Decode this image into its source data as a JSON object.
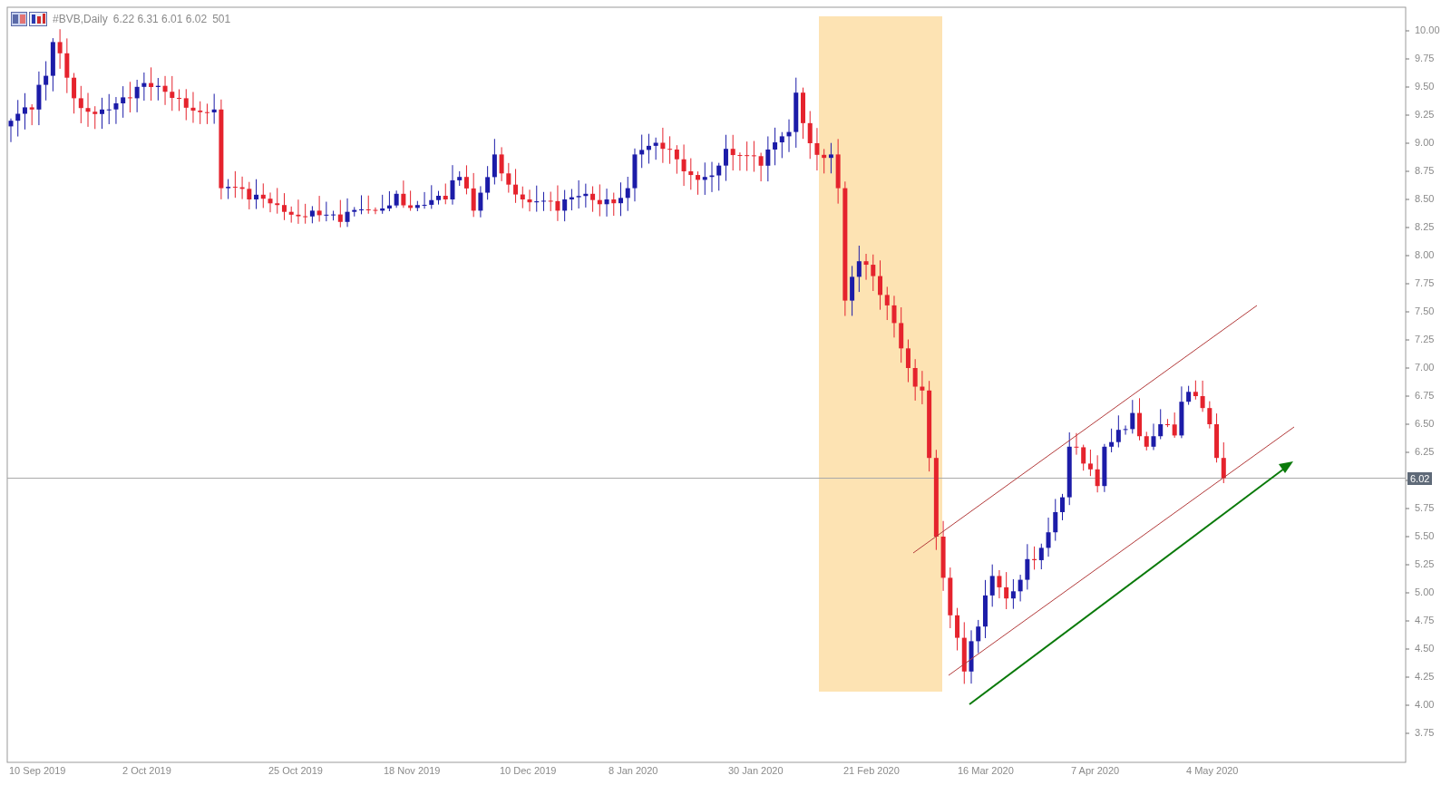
{
  "header": {
    "symbol": "#BVB,Daily",
    "ohlc": "6.22 6.31 6.01 6.02",
    "bars": "501"
  },
  "price_axis": [
    "10.00",
    "9.75",
    "9.50",
    "9.25",
    "9.00",
    "8.75",
    "8.50",
    "8.25",
    "8.00",
    "7.75",
    "7.50",
    "7.25",
    "7.00",
    "6.75",
    "6.50",
    "6.25",
    "5.75",
    "5.50",
    "5.25",
    "5.00",
    "4.75",
    "4.50",
    "4.25",
    "4.00",
    "3.75"
  ],
  "current_price": "6.02",
  "time_axis": [
    "10 Sep 2019",
    "2 Oct 2019",
    "25 Oct 2019",
    "18 Nov 2019",
    "10 Dec 2019",
    "8 Jan 2020",
    "30 Jan 2020",
    "21 Feb 2020",
    "16 Mar 2020",
    "7 Apr 2020",
    "4 May 2020"
  ]
}
